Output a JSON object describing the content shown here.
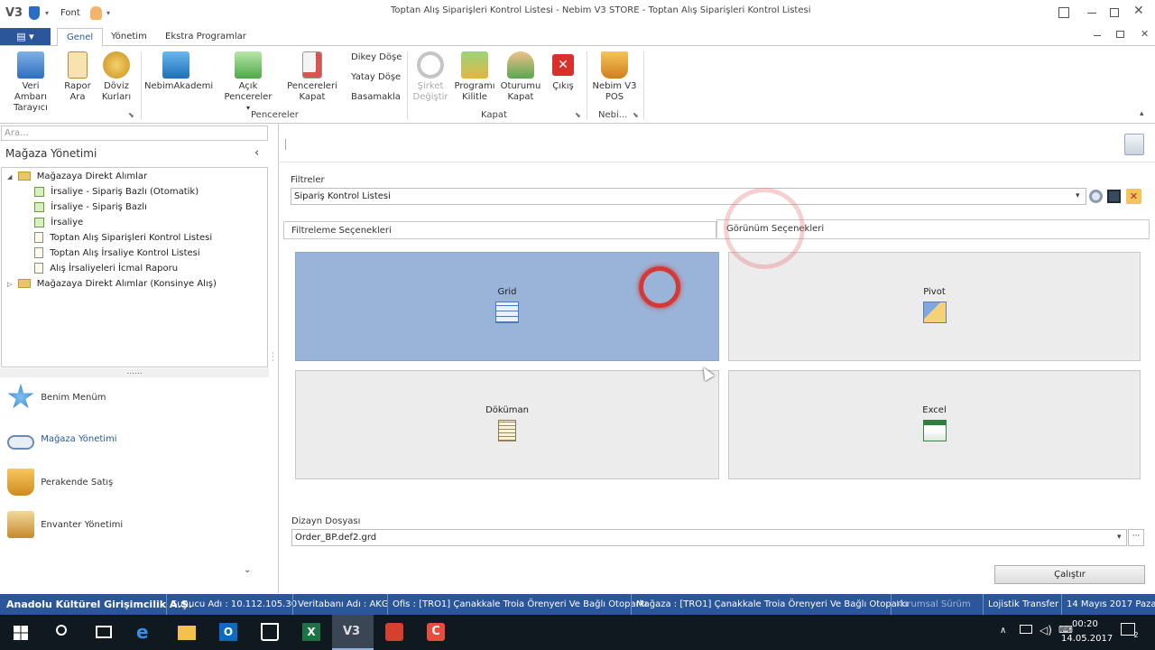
{
  "window": {
    "title": "Toptan Alış Siparişleri Kontrol Listesi - Nebim V3 STORE - Toptan Alış Siparişleri Kontrol Listesi",
    "qat_font_label": "Font",
    "app_logo": "V3"
  },
  "ribbon": {
    "file_tab": "▤ ▾",
    "tabs": [
      {
        "label": "Genel",
        "active": true
      },
      {
        "label": "Yönetim",
        "active": false
      },
      {
        "label": "Ekstra Programlar",
        "active": false
      }
    ],
    "buttons": {
      "veri_ambari": "Veri Ambarı Tarayıcı",
      "rapor_ara": "Rapor Ara",
      "doviz_kurlari": "Döviz Kurları",
      "nebim_akademi": "NebimAkademi",
      "acik_pencereler": "Açık Pencereler",
      "pencereleri_kapat": "Pencereleri Kapat",
      "dikey_dose": "Dikey Döşe",
      "yatay_dose": "Yatay Döşe",
      "basamakla": "Basamakla",
      "sirket_degistir": "Şirket Değiştir",
      "programi_kilitle": "Programı Kilitle",
      "oturumu_kapat": "Oturumu Kapat",
      "cikis": "Çıkış",
      "nebim_v3_pos": "Nebim V3 POS"
    },
    "groups": {
      "pencereler": "Pencereler",
      "kapat": "Kapat",
      "nebi": "Nebi..."
    }
  },
  "left_panel": {
    "search_placeholder": "Ara...",
    "title": "Mağaza Yönetimi",
    "tree": [
      {
        "label": "Mağazaya Direkt Alımlar",
        "type": "folder",
        "expanded": true
      },
      {
        "label": "İrsaliye - Sipariş Bazlı (Otomatik)",
        "type": "doc-green"
      },
      {
        "label": "İrsaliye - Sipariş Bazlı",
        "type": "doc-green"
      },
      {
        "label": "İrsaliye",
        "type": "doc-green"
      },
      {
        "label": "Toptan Alış Siparişleri Kontrol Listesi",
        "type": "doc"
      },
      {
        "label": "Toptan Alış İrsaliye Kontrol Listesi",
        "type": "doc"
      },
      {
        "label": "Alış İrsaliyeleri İcmal Raporu",
        "type": "doc"
      },
      {
        "label": "Mağazaya Direkt Alımlar (Konsinye Alış)",
        "type": "folder",
        "expanded": false
      }
    ],
    "splitter": "......",
    "nav": [
      {
        "label": "Benim Menüm",
        "icon": "star-icon"
      },
      {
        "label": "Mağaza Yönetimi",
        "icon": "store-icon",
        "active": true
      },
      {
        "label": "Perakende Satış",
        "icon": "cart-icon"
      },
      {
        "label": "Envanter Yönetimi",
        "icon": "inventory-icon"
      }
    ]
  },
  "main": {
    "filters_label": "Filtreler",
    "filter_value": "Sipariş Kontrol Listesi",
    "tabs": [
      {
        "label": "Filtreleme Seçenekleri",
        "active": false
      },
      {
        "label": "Görünüm Seçenekleri",
        "active": true
      }
    ],
    "tiles": [
      {
        "label": "Grid",
        "selected": true
      },
      {
        "label": "Pivot",
        "selected": false
      },
      {
        "label": "Döküman",
        "selected": false
      },
      {
        "label": "Excel",
        "selected": false
      }
    ],
    "design_file_label": "Dizayn Dosyası",
    "design_file_value": "Order_BP.def2.grd",
    "run_button": "Çalıştır"
  },
  "statusbar": {
    "company": "Anadolu Kültürel Girişimcilik A.Ş.",
    "server": "Sunucu Adı : 10.112.105.30",
    "database": "Veritabanı Adı : AKG",
    "office": "Ofis : [TRO1]  Çanakkale Troia Örenyeri Ve Bağlı Otoparkı",
    "store": "Mağaza : [TRO1]  Çanakkale Troia Örenyeri Ve Bağlı Otoparkı",
    "edition": "Kurumsal Sürüm",
    "logistics": "Lojistik Transfer",
    "date": "14 Mayıs 2017 Pazar"
  },
  "taskbar": {
    "time": "00:20",
    "date": "14.05.2017",
    "notif_count": "2"
  }
}
